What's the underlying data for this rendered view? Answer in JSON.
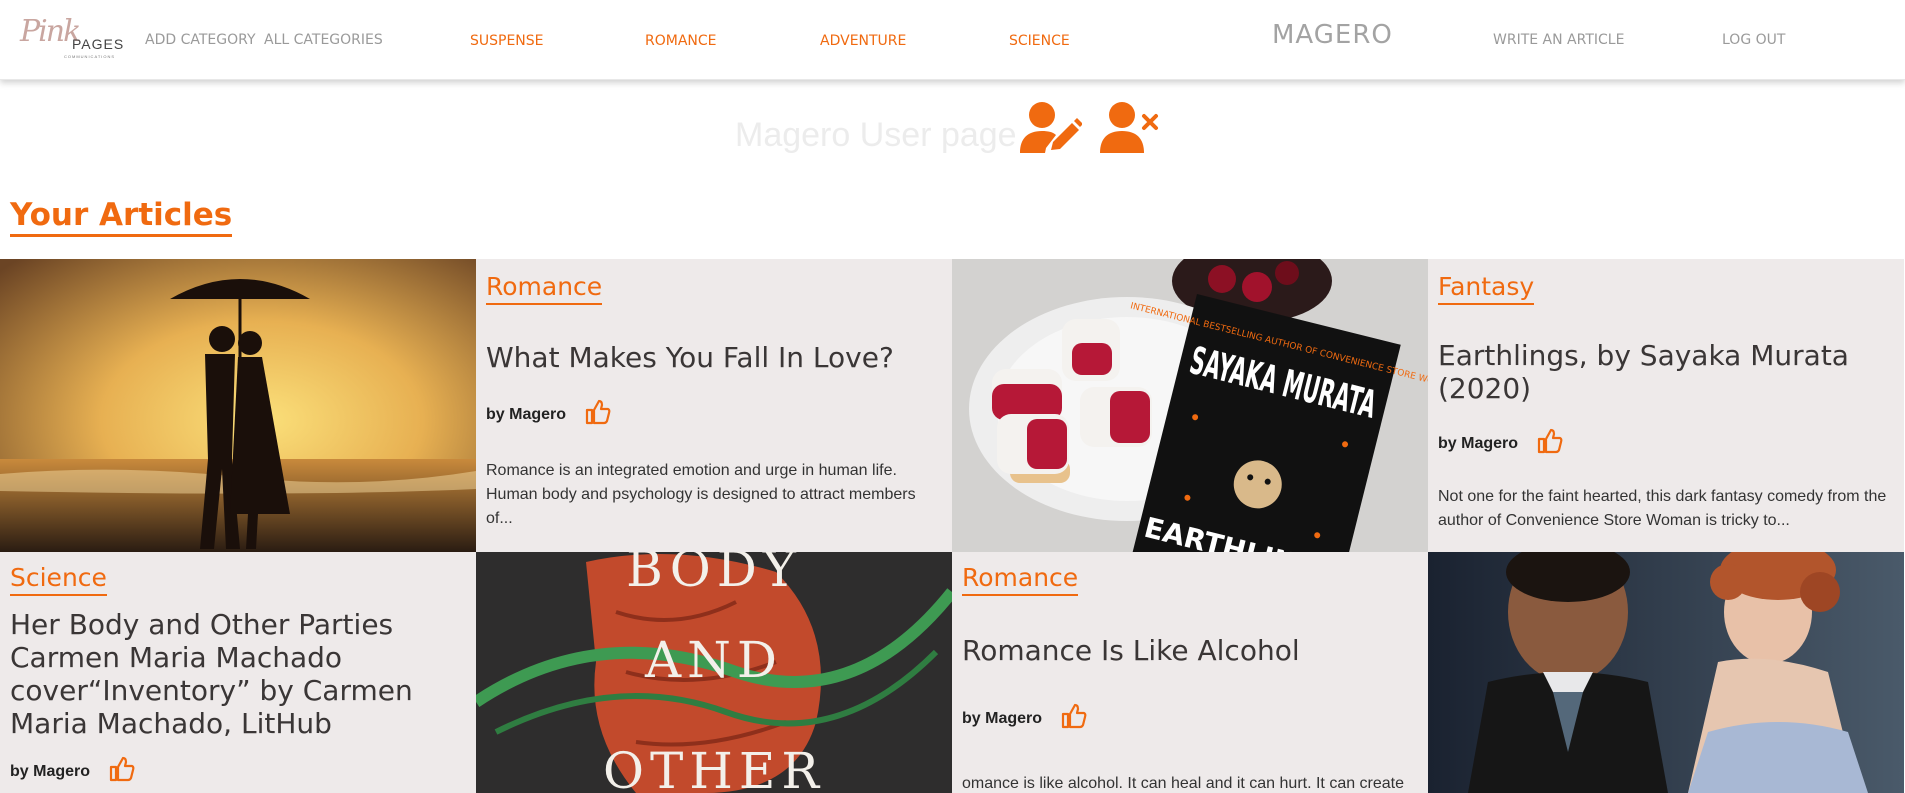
{
  "nav": {
    "logo_script": "Pink",
    "logo_word": "PAGES",
    "logo_tiny": "COMMUNICATIONS",
    "add_category": "ADD CATEGORY",
    "all_categories": "ALL CATEGORIES",
    "categories": [
      "SUSPENSE",
      "ROMANCE",
      "ADVENTURE",
      "SCIENCE"
    ],
    "brand": "MAGERO",
    "write_article": "WRITE AN ARTICLE",
    "logout": "LOG OUT"
  },
  "user": {
    "title": "Magero User page",
    "edit_icon": "user-edit-icon",
    "delete_icon": "user-remove-icon"
  },
  "section_title": "Your Articles",
  "articles": [
    {
      "category": "Romance",
      "title": "What Makes You Fall In Love?",
      "author": "by Magero",
      "excerpt": "Romance is an integrated emotion and urge in human life. Human body and psychology is designed to attract members of...",
      "image": "couple-umbrella-beach-sunset"
    },
    {
      "category": "Fantasy",
      "title": "Earthlings, by Sayaka Murata (2020)",
      "author": "by Magero",
      "excerpt": "Not one for the faint hearted, this dark fantasy comedy from the author of Convenience Store Woman is tricky to...",
      "image": "earthlings-book-popsicles",
      "cover_top": "INTERNATIONAL BESTSELLING AUTHOR OF CONVENIENCE STORE WOMAN",
      "cover_name": "SAYAKA MURATA",
      "cover_title": "EARTHLINGS"
    },
    {
      "category": "Science",
      "title": "Her Body and Other Parties Carmen Maria Machado cover“Inventory” by Carmen Maria Machado, LitHub",
      "author": "by Magero",
      "image": "her-body-book-cover",
      "cover_text": "BODY AND OTHER"
    },
    {
      "category": "Romance",
      "title": "Romance Is Like Alcohol",
      "author": "by Magero",
      "excerpt": "omance is like alcohol. It can heal and it can hurt. It can create",
      "image": "period-drama-couple"
    }
  ],
  "colors": {
    "accent": "#f06a10",
    "card_bg": "#eeeaea",
    "muted_nav": "#9a9a9a"
  }
}
